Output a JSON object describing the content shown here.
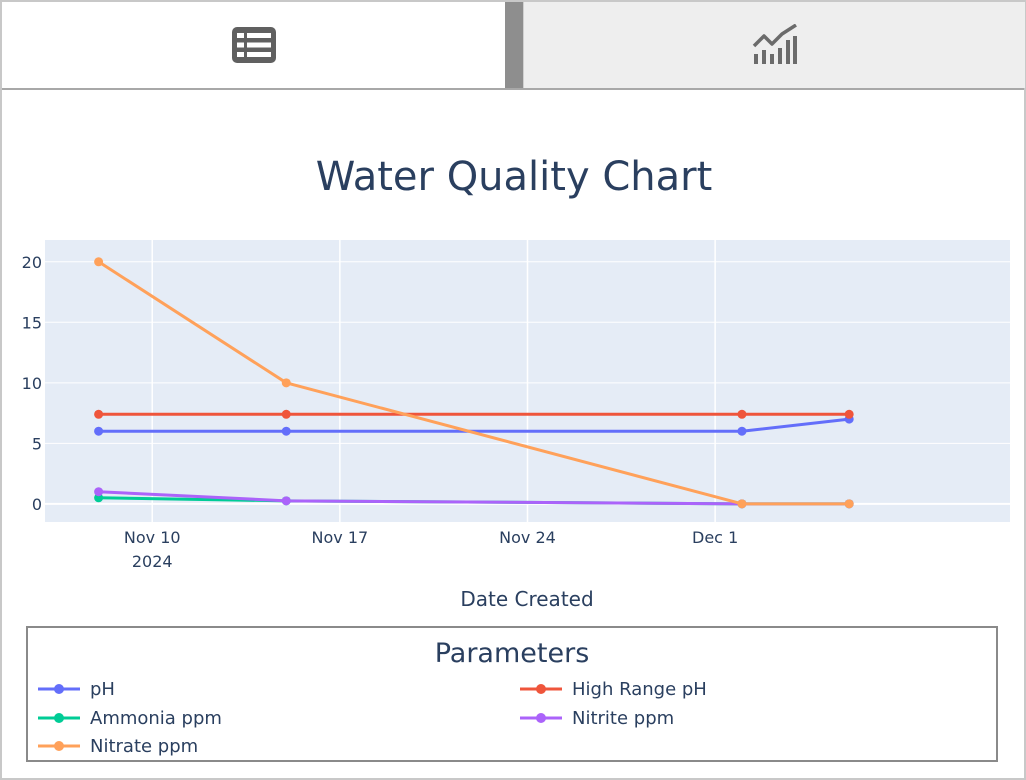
{
  "tabs": {
    "table": {
      "icon": "table-icon"
    },
    "chart": {
      "icon": "line-chart-icon"
    }
  },
  "chart_data": {
    "type": "line",
    "title": "Water Quality Chart",
    "xlabel": "Date Created",
    "ylabel": "",
    "x": [
      "2024-11-08",
      "2024-11-15",
      "2024-12-02",
      "2024-12-06"
    ],
    "x_range": [
      "2024-11-06",
      "2024-12-12"
    ],
    "x_ticks": [
      {
        "date": "2024-11-10",
        "label": "Nov 10",
        "sub": "2024"
      },
      {
        "date": "2024-11-17",
        "label": "Nov 17",
        "sub": ""
      },
      {
        "date": "2024-11-24",
        "label": "Nov 24",
        "sub": ""
      },
      {
        "date": "2024-12-01",
        "label": "Dec 1",
        "sub": ""
      }
    ],
    "ylim": [
      -1.5,
      21.8
    ],
    "y_ticks": [
      0,
      5,
      10,
      15,
      20
    ],
    "grid": true,
    "plot_bg": "#e5ecf6",
    "legend_title": "Parameters",
    "legend_position": "bottom",
    "series": [
      {
        "name": "pH",
        "color": "#636efa",
        "values": [
          6.0,
          6.0,
          6.0,
          7.0
        ]
      },
      {
        "name": "High Range pH",
        "color": "#ef553b",
        "values": [
          7.4,
          7.4,
          7.4,
          7.4
        ]
      },
      {
        "name": "Ammonia ppm",
        "color": "#00cc96",
        "values": [
          0.5,
          0.25,
          0,
          0
        ]
      },
      {
        "name": "Nitrite ppm",
        "color": "#ab63fa",
        "values": [
          1.0,
          0.25,
          0,
          0
        ]
      },
      {
        "name": "Nitrate ppm",
        "color": "#ffa15a",
        "values": [
          20,
          10,
          0,
          0
        ]
      }
    ]
  }
}
